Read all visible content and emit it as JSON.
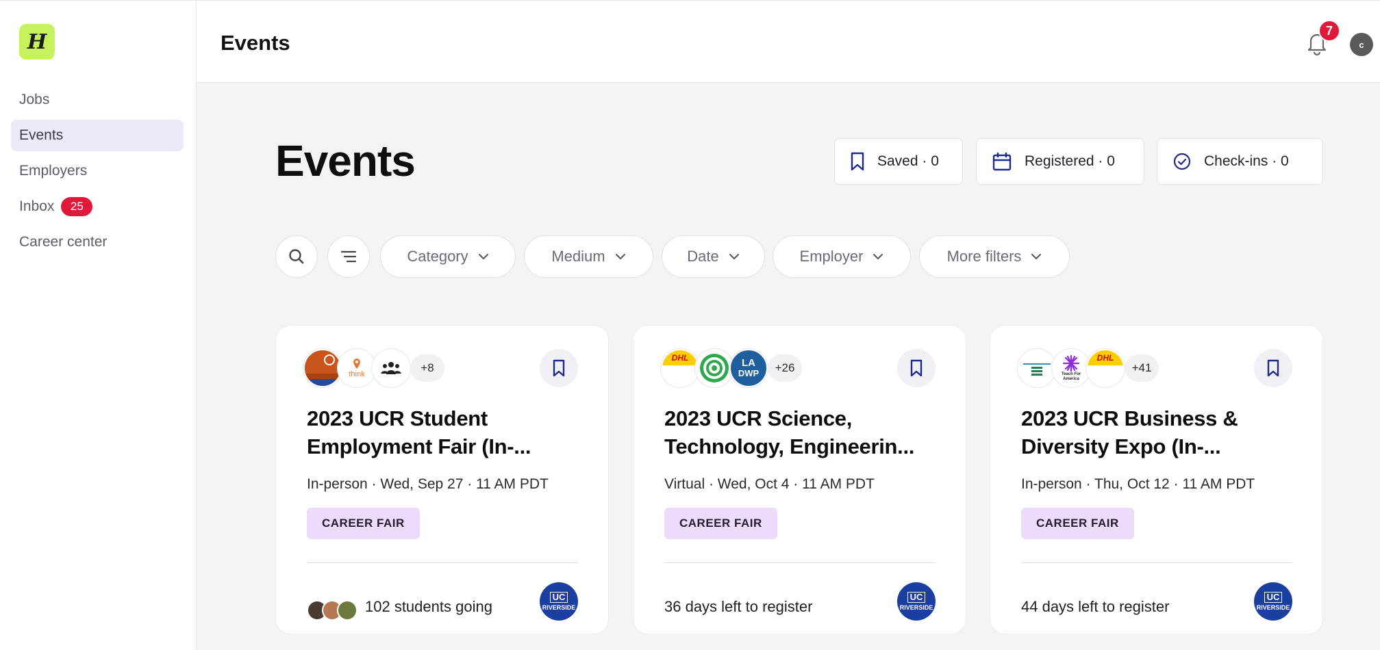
{
  "sidebar": {
    "logo": "H",
    "items": [
      {
        "label": "Jobs"
      },
      {
        "label": "Events"
      },
      {
        "label": "Employers"
      },
      {
        "label": "Inbox",
        "badge": "25"
      },
      {
        "label": "Career center"
      }
    ]
  },
  "topbar": {
    "title": "Events",
    "notification_count": "7",
    "avatar_initial": "c"
  },
  "main": {
    "title": "Events",
    "stats": {
      "saved": "Saved · 0",
      "registered": "Registered · 0",
      "checkins": "Check-ins · 0"
    },
    "filters": {
      "category": "Category",
      "medium": "Medium",
      "date": "Date",
      "employer": "Employer",
      "more": "More filters"
    }
  },
  "cards": [
    {
      "more_count": "+8",
      "logo_text": {
        "l2": "think"
      },
      "title": "2023 UCR Student Employment Fair (In-...",
      "meta": "In-person · Wed, Sep 27 · 11 AM PDT",
      "tag": "CAREER FAIR",
      "footer": "102 students going",
      "ucr": {
        "uc": "UC",
        "rv": "RIVERSIDE"
      }
    },
    {
      "more_count": "+26",
      "logo_text": {
        "l1": "DHL",
        "l3a": "LA",
        "l3b": "DWP"
      },
      "title": "2023 UCR Science, Technology, Engineerin...",
      "meta": "Virtual · Wed, Oct 4 · 11 AM PDT",
      "tag": "CAREER FAIR",
      "footer": "36 days left to register",
      "ucr": {
        "uc": "UC",
        "rv": "RIVERSIDE"
      }
    },
    {
      "more_count": "+41",
      "logo_text": {
        "l2": "Teach For America",
        "l3": "DHL"
      },
      "title": "2023 UCR Business & Diversity Expo (In-...",
      "meta": "In-person · Thu, Oct 12 · 11 AM PDT",
      "tag": "CAREER FAIR",
      "footer": "44 days left to register",
      "ucr": {
        "uc": "UC",
        "rv": "RIVERSIDE"
      }
    }
  ],
  "colors": {
    "accent_logo": "#c6f35b",
    "badge_red": "#e0193a",
    "tag_purple": "#ecdcf9",
    "ucr_blue": "#1b3fa0"
  }
}
